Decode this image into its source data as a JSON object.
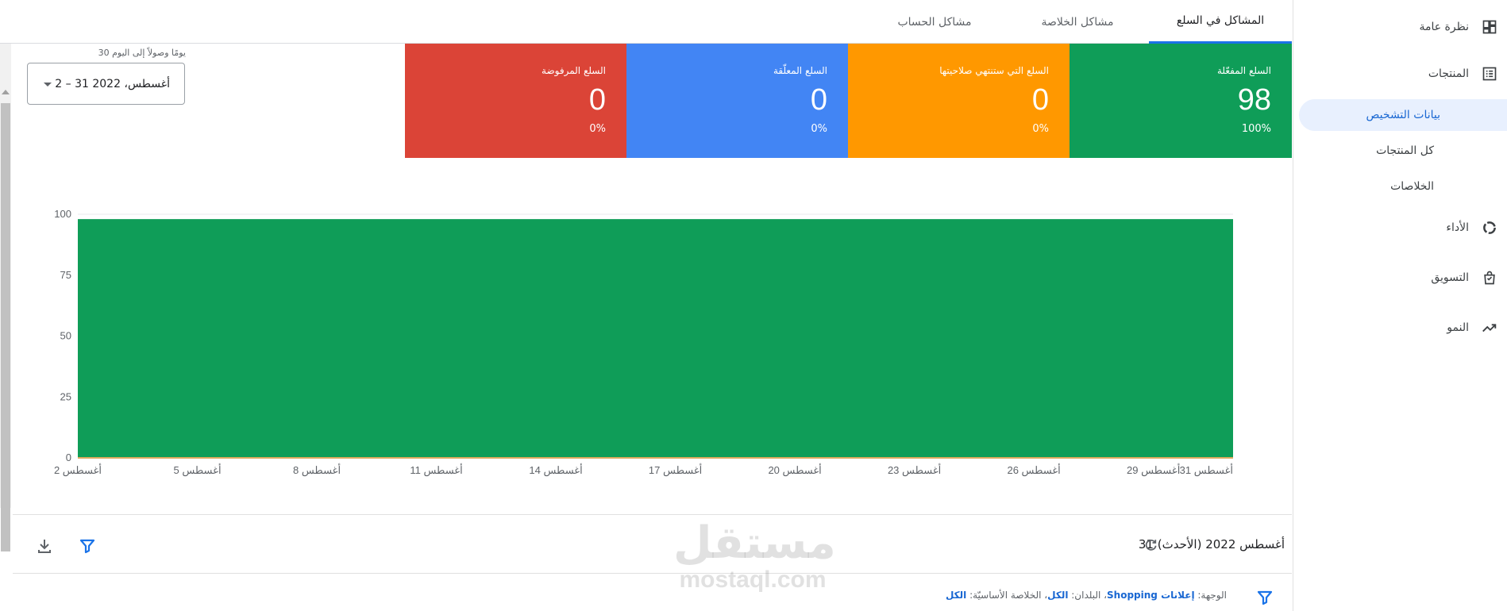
{
  "sidebar": {
    "items": [
      {
        "label": "نظرة عامة",
        "icon": "dashboard-icon"
      },
      {
        "label": "المنتجات",
        "icon": "list-icon"
      },
      {
        "label": "الأداء",
        "icon": "donut-icon"
      },
      {
        "label": "التسويق",
        "icon": "shopping-bag-icon"
      },
      {
        "label": "النمو",
        "icon": "trending-up-icon"
      }
    ],
    "sub_items": [
      {
        "label": "بيانات التشخيص",
        "active": true
      },
      {
        "label": "كل المنتجات",
        "active": false
      },
      {
        "label": "الخلاصات",
        "active": false
      }
    ]
  },
  "tabs": [
    {
      "label": "المشاكل في السلع",
      "active": true
    },
    {
      "label": "مشاكل الخلاصة",
      "active": false
    },
    {
      "label": "مشاكل الحساب",
      "active": false
    }
  ],
  "date_range": {
    "caption": "30 يومًا وصولاً إلى اليوم",
    "value": "2 – 31 أغسطس، 2022"
  },
  "cards": [
    {
      "title": "السلع المفعّلة",
      "value": "98",
      "percent": "100%",
      "color": "#0f9d58"
    },
    {
      "title": "السلع التي ستنتهي صلاحيتها",
      "value": "0",
      "percent": "0%",
      "color": "#ff9800"
    },
    {
      "title": "السلع المعلّقة",
      "value": "0",
      "percent": "0%",
      "color": "#4285f4"
    },
    {
      "title": "السلع المرفوضة",
      "value": "0",
      "percent": "0%",
      "color": "#db4437"
    }
  ],
  "chart_data": {
    "type": "area",
    "x": [
      "2 أغسطس",
      "3 أغسطس",
      "4 أغسطس",
      "5 أغسطس",
      "6 أغسطس",
      "7 أغسطس",
      "8 أغسطس",
      "9 أغسطس",
      "10 أغسطس",
      "11 أغسطس",
      "12 أغسطس",
      "13 أغسطس",
      "14 أغسطس",
      "15 أغسطس",
      "16 أغسطس",
      "17 أغسطس",
      "18 أغسطس",
      "19 أغسطس",
      "20 أغسطس",
      "21 أغسطس",
      "22 أغسطس",
      "23 أغسطس",
      "24 أغسطس",
      "25 أغسطس",
      "26 أغسطس",
      "27 أغسطس",
      "28 أغسطس",
      "29 أغسطس",
      "30 أغسطس",
      "31 أغسطس"
    ],
    "x_tick_labels": [
      "2 أغسطس",
      "5 أغسطس",
      "8 أغسطس",
      "11 أغسطس",
      "14 أغسطس",
      "17 أغسطس",
      "20 أغسطس",
      "23 أغسطس",
      "26 أغسطس",
      "29 أغسطس",
      "31 أغسطس"
    ],
    "series": [
      {
        "values": [
          98,
          98,
          98,
          98,
          98,
          98,
          98,
          98,
          98,
          98,
          98,
          98,
          98,
          98,
          98,
          98,
          98,
          98,
          98,
          98,
          98,
          98,
          98,
          98,
          98,
          98,
          98,
          98,
          98,
          98
        ],
        "color": "#0f9d58"
      },
      {
        "values": [
          0,
          0,
          0,
          0,
          0,
          0,
          0,
          0,
          0,
          0,
          0,
          0,
          0,
          0,
          0,
          0,
          0,
          0,
          0,
          0,
          0,
          0,
          0,
          0,
          0,
          0,
          0,
          0,
          0,
          0
        ],
        "color": "#ff9800"
      }
    ],
    "ylim": [
      0,
      100
    ],
    "y_ticks": [
      0,
      25,
      50,
      75,
      100
    ],
    "grid": true
  },
  "footer": {
    "updated": "31 أغسطس 2022 (الأحدث)",
    "filter_parts": [
      {
        "key": "الوجهة: ",
        "value": "إعلانات Shopping"
      },
      {
        "key": "، البلدان: ",
        "value": "الكل"
      },
      {
        "key": "، الخلاصة الأساسيّة: ",
        "value": "الكل"
      }
    ]
  },
  "watermark": {
    "line1": "مستقل",
    "line2": "mostaql.com"
  },
  "colors": {
    "accent": "#1a73e8",
    "active_bg": "#e8f0fe"
  }
}
